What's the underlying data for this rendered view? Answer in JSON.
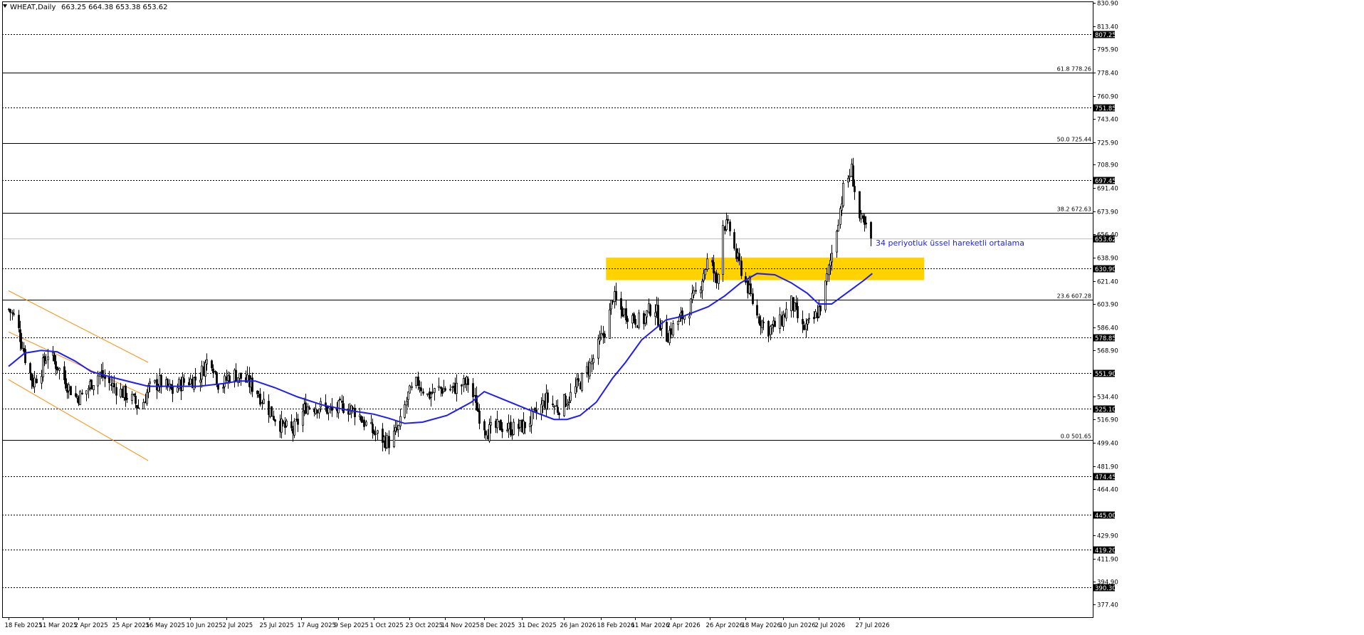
{
  "header": {
    "symbol": "WHEAT,Daily",
    "ohlc": "663.25 664.38 653.38 653.62"
  },
  "chart_data": {
    "type": "candlestick",
    "price_axis": {
      "range": [
        368,
        832
      ],
      "ticks": [
        "830.90",
        "813.40",
        "795.90",
        "778.40",
        "760.90",
        "743.40",
        "725.90",
        "708.90",
        "691.40",
        "673.90",
        "656.40",
        "638.90",
        "621.40",
        "603.90",
        "586.40",
        "568.90",
        "534.40",
        "516.90",
        "499.40",
        "481.90",
        "464.40",
        "429.90",
        "411.90",
        "394.90",
        "377.40"
      ]
    },
    "time_axis": {
      "start": "2025-02-18",
      "end": "2026-08-03",
      "labels": [
        {
          "date": "2025-02-18",
          "label": "18 Feb 2025"
        },
        {
          "date": "2025-03-11",
          "label": "11 Mar 2025"
        },
        {
          "date": "2025-04-02",
          "label": "2 Apr 2025"
        },
        {
          "date": "2025-04-25",
          "label": "25 Apr 2025"
        },
        {
          "date": "2025-05-16",
          "label": "16 May 2025"
        },
        {
          "date": "2025-06-10",
          "label": "10 Jun 2025"
        },
        {
          "date": "2025-07-02",
          "label": "2 Jul 2025"
        },
        {
          "date": "2025-07-25",
          "label": "25 Jul 2025"
        },
        {
          "date": "2025-08-17",
          "label": "17 Aug 2025"
        },
        {
          "date": "2025-09-09",
          "label": "9 Sep 2025"
        },
        {
          "date": "2025-10-01",
          "label": "1 Oct 2025"
        },
        {
          "date": "2025-10-23",
          "label": "23 Oct 2025"
        },
        {
          "date": "2025-11-14",
          "label": "14 Nov 2025"
        },
        {
          "date": "2025-12-08",
          "label": "8 Dec 2025"
        },
        {
          "date": "2025-12-31",
          "label": "31 Dec 2025"
        },
        {
          "date": "2026-01-26",
          "label": "26 Jan 2026"
        },
        {
          "date": "2026-02-18",
          "label": "18 Feb 2026"
        },
        {
          "date": "2026-03-11",
          "label": "11 Mar 2026"
        },
        {
          "date": "2026-04-02",
          "label": "2 Apr 2026"
        },
        {
          "date": "2026-04-26",
          "label": "26 Apr 2026"
        },
        {
          "date": "2026-05-18",
          "label": "18 May 2026"
        },
        {
          "date": "2026-06-10",
          "label": "10 Jun 2026"
        },
        {
          "date": "2026-07-02",
          "label": "2 Jul 2026"
        },
        {
          "date": "2026-07-27",
          "label": "27 Jul 2026"
        }
      ]
    },
    "levels": [
      {
        "value": 807.25,
        "label": "807.25",
        "style": "dotted",
        "boxed": true
      },
      {
        "value": 751.85,
        "label": "751.85",
        "style": "dotted",
        "boxed": true
      },
      {
        "value": 697.45,
        "label": "697.45",
        "style": "dotted",
        "boxed": true
      },
      {
        "value": 630.9,
        "label": "630.90",
        "style": "dotted",
        "boxed": true
      },
      {
        "value": 578.85,
        "label": "578.85",
        "style": "dotted",
        "boxed": true
      },
      {
        "value": 551.9,
        "label": "551.90",
        "style": "dotted",
        "boxed": true
      },
      {
        "value": 525.1,
        "label": "525.10",
        "style": "dotted",
        "boxed": true
      },
      {
        "value": 474.45,
        "label": "474.45",
        "style": "dotted",
        "boxed": true
      },
      {
        "value": 445.0,
        "label": "445.00",
        "style": "dotted",
        "boxed": true
      },
      {
        "value": 419.2,
        "label": "419.20",
        "style": "dotted",
        "boxed": true
      },
      {
        "value": 390.3,
        "label": "390.30",
        "style": "dotted",
        "boxed": true
      }
    ],
    "fibonacci": [
      {
        "value": 778.26,
        "label": "61.8 778.26"
      },
      {
        "value": 725.44,
        "label": "50.0 725.44"
      },
      {
        "value": 672.63,
        "label": "38.2 672.63"
      },
      {
        "value": 607.28,
        "label": "23.6 607.28"
      },
      {
        "value": 501.65,
        "label": "0.0 501.65"
      }
    ],
    "current_price": {
      "value": 653.62,
      "label": "653.62"
    },
    "zone": {
      "start": "2026-02-21",
      "end": "2026-09-05",
      "low": 622,
      "high": 639,
      "color": "#FFD200"
    },
    "ema": {
      "label": "34 periyotluk üssel hareketli ortalama",
      "color": "#1C1CFF",
      "points": [
        [
          "2025-02-18",
          557
        ],
        [
          "2025-02-28",
          567
        ],
        [
          "2025-03-10",
          569
        ],
        [
          "2025-03-20",
          568
        ],
        [
          "2025-03-31",
          561
        ],
        [
          "2025-04-10",
          553
        ],
        [
          "2025-04-22",
          549
        ],
        [
          "2025-05-05",
          545
        ],
        [
          "2025-05-15",
          542
        ],
        [
          "2025-05-30",
          542
        ],
        [
          "2025-06-15",
          542
        ],
        [
          "2025-06-30",
          544
        ],
        [
          "2025-07-10",
          546
        ],
        [
          "2025-07-20",
          546
        ],
        [
          "2025-08-01",
          541
        ],
        [
          "2025-08-15",
          534
        ],
        [
          "2025-08-30",
          528
        ],
        [
          "2025-09-15",
          524
        ],
        [
          "2025-10-01",
          521
        ],
        [
          "2025-10-10",
          518
        ],
        [
          "2025-10-20",
          514
        ],
        [
          "2025-10-31",
          515
        ],
        [
          "2025-11-15",
          520
        ],
        [
          "2025-11-30",
          530
        ],
        [
          "2025-12-08",
          538
        ],
        [
          "2025-12-20",
          532
        ],
        [
          "2026-01-05",
          524
        ],
        [
          "2026-01-20",
          517
        ],
        [
          "2026-01-28",
          517
        ],
        [
          "2026-02-05",
          520
        ],
        [
          "2026-02-15",
          530
        ],
        [
          "2026-02-25",
          548
        ],
        [
          "2026-03-05",
          560
        ],
        [
          "2026-03-15",
          577
        ],
        [
          "2026-03-30",
          592
        ],
        [
          "2026-04-10",
          595
        ],
        [
          "2026-04-25",
          602
        ],
        [
          "2026-05-05",
          610
        ],
        [
          "2026-05-15",
          620
        ],
        [
          "2026-05-25",
          627
        ],
        [
          "2026-06-05",
          626
        ],
        [
          "2026-06-15",
          620
        ],
        [
          "2026-06-25",
          612
        ],
        [
          "2026-07-02",
          604
        ],
        [
          "2026-07-10",
          604
        ],
        [
          "2026-07-20",
          613
        ],
        [
          "2026-07-30",
          622
        ],
        [
          "2026-08-04",
          627
        ]
      ]
    },
    "channel": {
      "color": "#FF8C00",
      "lines": [
        [
          [
            "2025-02-18",
            614
          ],
          [
            "2025-05-15",
            560
          ]
        ],
        [
          [
            "2025-02-18",
            583
          ],
          [
            "2025-05-15",
            534
          ]
        ],
        [
          [
            "2025-02-18",
            547
          ],
          [
            "2025-05-15",
            486
          ]
        ]
      ]
    },
    "ohlc_anchors": [
      [
        "2025-02-18",
        600
      ],
      [
        "2025-02-22",
        593
      ],
      [
        "2025-02-26",
        575
      ],
      [
        "2025-03-01",
        558
      ],
      [
        "2025-03-05",
        545
      ],
      [
        "2025-03-10",
        555
      ],
      [
        "2025-03-14",
        567
      ],
      [
        "2025-03-20",
        557
      ],
      [
        "2025-03-25",
        545
      ],
      [
        "2025-03-31",
        534
      ],
      [
        "2025-04-05",
        535
      ],
      [
        "2025-04-10",
        545
      ],
      [
        "2025-04-15",
        552
      ],
      [
        "2025-04-20",
        545
      ],
      [
        "2025-04-28",
        538
      ],
      [
        "2025-05-05",
        532
      ],
      [
        "2025-05-10",
        525
      ],
      [
        "2025-05-15",
        540
      ],
      [
        "2025-05-22",
        545
      ],
      [
        "2025-05-30",
        538
      ],
      [
        "2025-06-05",
        545
      ],
      [
        "2025-06-15",
        548
      ],
      [
        "2025-06-22",
        566
      ],
      [
        "2025-06-28",
        540
      ],
      [
        "2025-07-05",
        552
      ],
      [
        "2025-07-12",
        548
      ],
      [
        "2025-07-20",
        540
      ],
      [
        "2025-07-28",
        525
      ],
      [
        "2025-08-05",
        512
      ],
      [
        "2025-08-12",
        508
      ],
      [
        "2025-08-20",
        527
      ],
      [
        "2025-08-28",
        527
      ],
      [
        "2025-09-05",
        523
      ],
      [
        "2025-09-12",
        527
      ],
      [
        "2025-09-20",
        523
      ],
      [
        "2025-09-28",
        510
      ],
      [
        "2025-10-05",
        503
      ],
      [
        "2025-10-10",
        500
      ],
      [
        "2025-10-16",
        510
      ],
      [
        "2025-10-22",
        535
      ],
      [
        "2025-10-28",
        545
      ],
      [
        "2025-11-03",
        535
      ],
      [
        "2025-11-10",
        540
      ],
      [
        "2025-11-18",
        540
      ],
      [
        "2025-11-28",
        545
      ],
      [
        "2025-12-05",
        520
      ],
      [
        "2025-12-10",
        508
      ],
      [
        "2025-12-18",
        512
      ],
      [
        "2025-12-25",
        510
      ],
      [
        "2026-01-01",
        512
      ],
      [
        "2026-01-08",
        520
      ],
      [
        "2026-01-15",
        532
      ],
      [
        "2026-01-22",
        525
      ],
      [
        "2026-01-30",
        535
      ],
      [
        "2026-02-05",
        545
      ],
      [
        "2026-02-12",
        560
      ],
      [
        "2026-02-18",
        578
      ],
      [
        "2026-02-22",
        590
      ],
      [
        "2026-02-25",
        610
      ],
      [
        "2026-03-01",
        600
      ],
      [
        "2026-03-08",
        595
      ],
      [
        "2026-03-15",
        590
      ],
      [
        "2026-03-22",
        605
      ],
      [
        "2026-03-29",
        578
      ],
      [
        "2026-04-05",
        590
      ],
      [
        "2026-04-12",
        598
      ],
      [
        "2026-04-20",
        620
      ],
      [
        "2026-04-25",
        640
      ],
      [
        "2026-04-30",
        620
      ],
      [
        "2026-05-04",
        665
      ],
      [
        "2026-05-08",
        660
      ],
      [
        "2026-05-12",
        640
      ],
      [
        "2026-05-18",
        620
      ],
      [
        "2026-05-25",
        595
      ],
      [
        "2026-06-01",
        585
      ],
      [
        "2026-06-08",
        590
      ],
      [
        "2026-06-15",
        605
      ],
      [
        "2026-06-22",
        585
      ],
      [
        "2026-06-28",
        590
      ],
      [
        "2026-07-04",
        605
      ],
      [
        "2026-07-08",
        630
      ],
      [
        "2026-07-12",
        655
      ],
      [
        "2026-07-17",
        690
      ],
      [
        "2026-07-22",
        705
      ],
      [
        "2026-07-27",
        668
      ],
      [
        "2026-08-03",
        653.62
      ]
    ]
  }
}
